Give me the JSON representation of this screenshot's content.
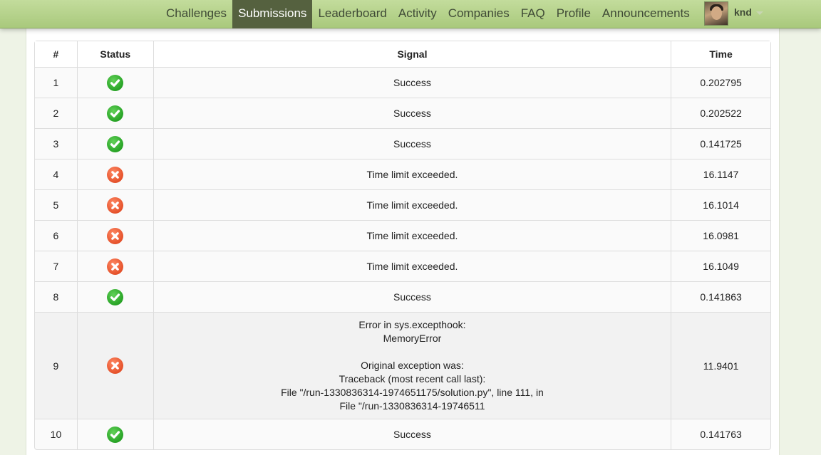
{
  "nav": {
    "items": [
      {
        "label": "Challenges",
        "active": false
      },
      {
        "label": "Submissions",
        "active": true
      },
      {
        "label": "Leaderboard",
        "active": false
      },
      {
        "label": "Activity",
        "active": false
      },
      {
        "label": "Companies",
        "active": false
      },
      {
        "label": "FAQ",
        "active": false
      },
      {
        "label": "Profile",
        "active": false
      },
      {
        "label": "Announcements",
        "active": false
      }
    ],
    "active_bg": "#55613f"
  },
  "user": {
    "name": "knd",
    "avatar_icon": "user-avatar-photo"
  },
  "table": {
    "headers": {
      "num": "#",
      "status": "Status",
      "signal": "Signal",
      "time": "Time"
    },
    "rows": [
      {
        "num": "1",
        "status": "success",
        "signal": "Success",
        "time": "0.202795"
      },
      {
        "num": "2",
        "status": "success",
        "signal": "Success",
        "time": "0.202522"
      },
      {
        "num": "3",
        "status": "success",
        "signal": "Success",
        "time": "0.141725"
      },
      {
        "num": "4",
        "status": "fail",
        "signal": "Time limit exceeded.",
        "time": "16.1147"
      },
      {
        "num": "5",
        "status": "fail",
        "signal": "Time limit exceeded.",
        "time": "16.1014"
      },
      {
        "num": "6",
        "status": "fail",
        "signal": "Time limit exceeded.",
        "time": "16.0981"
      },
      {
        "num": "7",
        "status": "fail",
        "signal": "Time limit exceeded.",
        "time": "16.1049"
      },
      {
        "num": "8",
        "status": "success",
        "signal": "Success",
        "time": "0.141863"
      },
      {
        "num": "9",
        "status": "fail",
        "signal": "Error in sys.excepthook:\nMemoryError\n\nOriginal exception was:\nTraceback (most recent call last):\nFile \"/run-1330836314-1974651175/solution.py\", line 111, in\nFile \"/run-1330836314-19746511",
        "time": "11.9401"
      },
      {
        "num": "10",
        "status": "success",
        "signal": "Success",
        "time": "0.141763"
      }
    ]
  },
  "colors": {
    "success": "#2aa828",
    "fail": "#e5512a",
    "topbar": "#b5d38b"
  }
}
